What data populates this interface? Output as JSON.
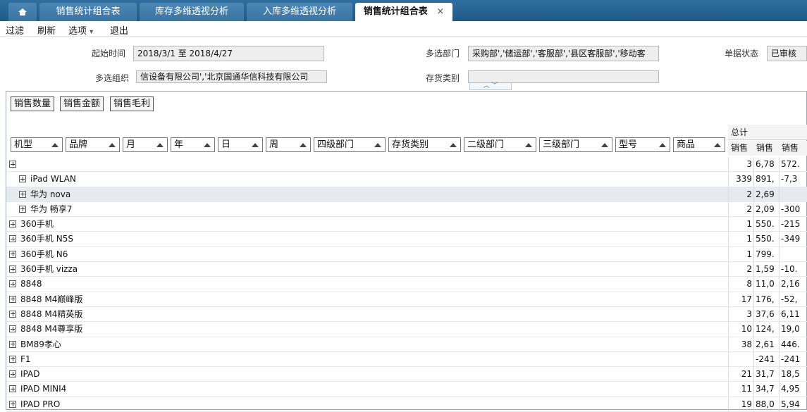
{
  "tabs": {
    "home_icon": "home-icon",
    "items": [
      {
        "label": "销售统计组合表"
      },
      {
        "label": "库存多维透视分析"
      },
      {
        "label": "入库多维透视分析"
      }
    ],
    "active": {
      "label": "销售统计组合表",
      "close": "×"
    }
  },
  "toolbar": {
    "filter": "过滤",
    "refresh": "刷新",
    "options": "选项",
    "options_caret": "▾",
    "exit": "退出"
  },
  "filters": {
    "start_time_label": "起始时间",
    "start_time_value": "2018/3/1 至 2018/4/27",
    "dept_label": "多选部门",
    "dept_value": "采购部','储运部','客服部','县区客服部','移动客",
    "status_label": "单据状态",
    "status_value": "已审核",
    "org_label": "多选组织",
    "org_value": "信设备有限公司','北京国通华信科技有限公司",
    "inv_label": "存货类别",
    "inv_value": "",
    "collapse": "︿ ﹀"
  },
  "measure_buttons": [
    "销售数量",
    "销售金额",
    "销售毛利"
  ],
  "grid": {
    "total_label": "总计",
    "dimensions": [
      "机型",
      "品牌",
      "月",
      "年",
      "日",
      "周",
      "四级部门",
      "存货类别",
      "二级部门",
      "三级部门",
      "型号",
      "商品"
    ],
    "measure_headers": [
      "销售",
      "销售",
      "销售"
    ],
    "rows": [
      {
        "label": "",
        "v1": "3",
        "v2": "6,78",
        "v3": "572."
      },
      {
        "label": "iPad WLAN",
        "v1": "339",
        "v2": "891,",
        "v3": "-7,3"
      },
      {
        "label": "华为  nova",
        "v1": "2",
        "v2": "2,69",
        "v3": ""
      },
      {
        "label": "华为  畅享7",
        "v1": "2",
        "v2": "2,09",
        "v3": "-300"
      },
      {
        "label": "360手机",
        "v1": "1",
        "v2": "550.",
        "v3": "-215"
      },
      {
        "label": "360手机  N5S",
        "v1": "1",
        "v2": "550.",
        "v3": "-349"
      },
      {
        "label": "360手机  N6",
        "v1": "1",
        "v2": "799.",
        "v3": ""
      },
      {
        "label": "360手机  vizza",
        "v1": "2",
        "v2": "1,59",
        "v3": "-10."
      },
      {
        "label": "8848",
        "v1": "8",
        "v2": "11,0",
        "v3": "2,16"
      },
      {
        "label": "8848 M4巅峰版",
        "v1": "17",
        "v2": "176,",
        "v3": "-52,"
      },
      {
        "label": "8848 M4精英版",
        "v1": "3",
        "v2": "37,6",
        "v3": "6,11"
      },
      {
        "label": "8848 M4尊享版",
        "v1": "10",
        "v2": "124,",
        "v3": "19,0"
      },
      {
        "label": "BM89孝心",
        "v1": "38",
        "v2": "2,61",
        "v3": "446."
      },
      {
        "label": "F1",
        "v1": "",
        "v2": "-241",
        "v3": "-241"
      },
      {
        "label": "IPAD",
        "v1": "21",
        "v2": "31,7",
        "v3": "18,5"
      },
      {
        "label": "IPAD MINI4",
        "v1": "11",
        "v2": "34,7",
        "v3": "4,95"
      },
      {
        "label": "IPAD PRO",
        "v1": "19",
        "v2": "88,0",
        "v3": "5,94"
      }
    ]
  }
}
